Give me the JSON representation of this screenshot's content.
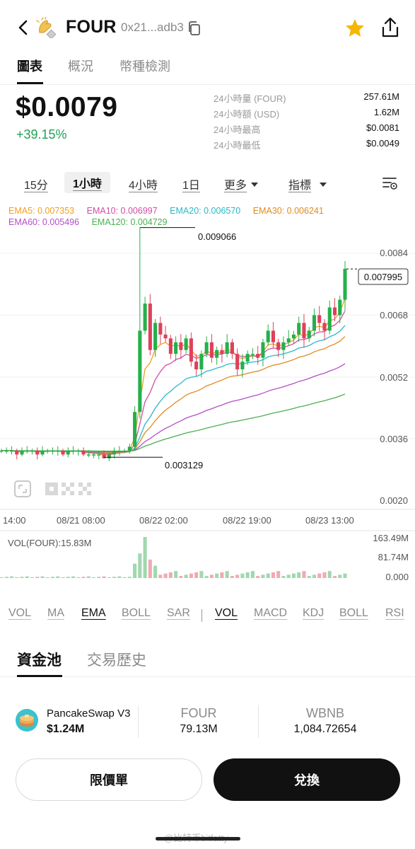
{
  "header": {
    "token": "FOUR",
    "address": "0x21...adb3",
    "icons": {
      "back": "chevron-left-icon",
      "copy": "copy-icon",
      "favorite": "star-icon",
      "share": "share-icon"
    },
    "favorite_color": "#f5b700"
  },
  "top_tabs": [
    {
      "label": "圖表",
      "active": true
    },
    {
      "label": "概況",
      "active": false
    },
    {
      "label": "幣種檢測",
      "active": false
    }
  ],
  "price": {
    "value": "$0.0079",
    "change": "+39.15%",
    "change_color": "#21a155"
  },
  "stats": [
    {
      "label": "24小時量 (FOUR)",
      "value": "257.61M"
    },
    {
      "label": "24小時額 (USD)",
      "value": "1.62M"
    },
    {
      "label": "24小時最高",
      "value": "$0.0081"
    },
    {
      "label": "24小時最低",
      "value": "$0.0049"
    }
  ],
  "timeframes": [
    {
      "label": "15分",
      "active": false
    },
    {
      "label": "1小時",
      "active": true
    },
    {
      "label": "4小時",
      "active": false
    },
    {
      "label": "1日",
      "active": false
    }
  ],
  "more_label": "更多",
  "indicator_label": "指標",
  "ema_legend": [
    {
      "label": "EMA5: 0.007353",
      "color": "#f0a020"
    },
    {
      "label": "EMA10: 0.006997",
      "color": "#d04fa0"
    },
    {
      "label": "EMA20: 0.006570",
      "color": "#2bb8c8"
    },
    {
      "label": "EMA30: 0.006241",
      "color": "#e08a1e"
    },
    {
      "label": "EMA60: 0.005496",
      "color": "#b44fc8"
    },
    {
      "label": "EMA120: 0.004729",
      "color": "#4caf50"
    }
  ],
  "chart": {
    "y_ticks": [
      "0.0084",
      "0.0068",
      "0.0052",
      "0.0036",
      "0.0020"
    ],
    "x_ticks": [
      "14:00",
      "08/21 08:00",
      "08/22 02:00",
      "08/22 19:00",
      "08/23 13:00"
    ],
    "high_label": "0.009066",
    "low_label": "0.003129",
    "last_price_label": "0.007995",
    "up_color": "#25b04a",
    "down_color": "#e0405a",
    "vol_label": "VOL(FOUR):15.83M",
    "vol_ticks": [
      "163.49M",
      "81.74M",
      "0.000"
    ]
  },
  "chart_data": {
    "type": "candlestick",
    "y_axis_ticks": [
      0.0084,
      0.0068,
      0.0052,
      0.0036,
      0.002
    ],
    "high": 0.009066,
    "low": 0.003129,
    "last": 0.007995,
    "close_series": [
      0.0033,
      0.0033,
      0.0033,
      0.0032,
      0.0033,
      0.0033,
      0.0033,
      0.0032,
      0.0033,
      0.0033,
      0.0033,
      0.0033,
      0.0032,
      0.0033,
      0.0033,
      0.0033,
      0.0032,
      0.0032,
      0.0032,
      0.0032,
      0.0031,
      0.0032,
      0.0033,
      0.0033,
      0.0033,
      0.0034,
      0.0043,
      0.0064,
      0.0071,
      0.0059,
      0.0066,
      0.0063,
      0.0062,
      0.0058,
      0.0061,
      0.0059,
      0.0062,
      0.0056,
      0.0054,
      0.0058,
      0.0061,
      0.0057,
      0.0059,
      0.0058,
      0.0061,
      0.0058,
      0.0054,
      0.0056,
      0.0058,
      0.0058,
      0.0057,
      0.0061,
      0.0064,
      0.0061,
      0.0059,
      0.0061,
      0.0062,
      0.0063,
      0.0066,
      0.0062,
      0.0064,
      0.0068,
      0.0066,
      0.0064,
      0.007,
      0.0068,
      0.0072,
      0.008
    ],
    "ema": {
      "EMA5": 0.007353,
      "EMA10": 0.006997,
      "EMA20": 0.00657,
      "EMA30": 0.006241,
      "EMA60": 0.005496,
      "EMA120": 0.004729
    },
    "volume_axis_ticks": [
      163.49,
      81.74,
      0
    ],
    "volume_unit": "M",
    "current_volume": "15.83M"
  },
  "indicators_main": [
    {
      "label": "VOL",
      "active": false
    },
    {
      "label": "MA",
      "active": false
    },
    {
      "label": "EMA",
      "active": true
    },
    {
      "label": "BOLL",
      "active": false
    },
    {
      "label": "SAR",
      "active": false
    }
  ],
  "indicators_sub": [
    {
      "label": "VOL",
      "active": true
    },
    {
      "label": "MACD",
      "active": false
    },
    {
      "label": "KDJ",
      "active": false
    },
    {
      "label": "BOLL",
      "active": false
    },
    {
      "label": "RSI",
      "active": false
    }
  ],
  "section_tabs": [
    {
      "label": "資金池",
      "active": true
    },
    {
      "label": "交易歷史",
      "active": false
    }
  ],
  "pool": {
    "name": "PancakeSwap V3",
    "tvl": "$1.24M",
    "col1_head": "FOUR",
    "col1_val": "79.13M",
    "col2_head": "WBNB",
    "col2_val": "1,084.72654"
  },
  "buttons": {
    "limit": "限價單",
    "swap": "兌換"
  },
  "watermark": "@比特币bitfatty"
}
